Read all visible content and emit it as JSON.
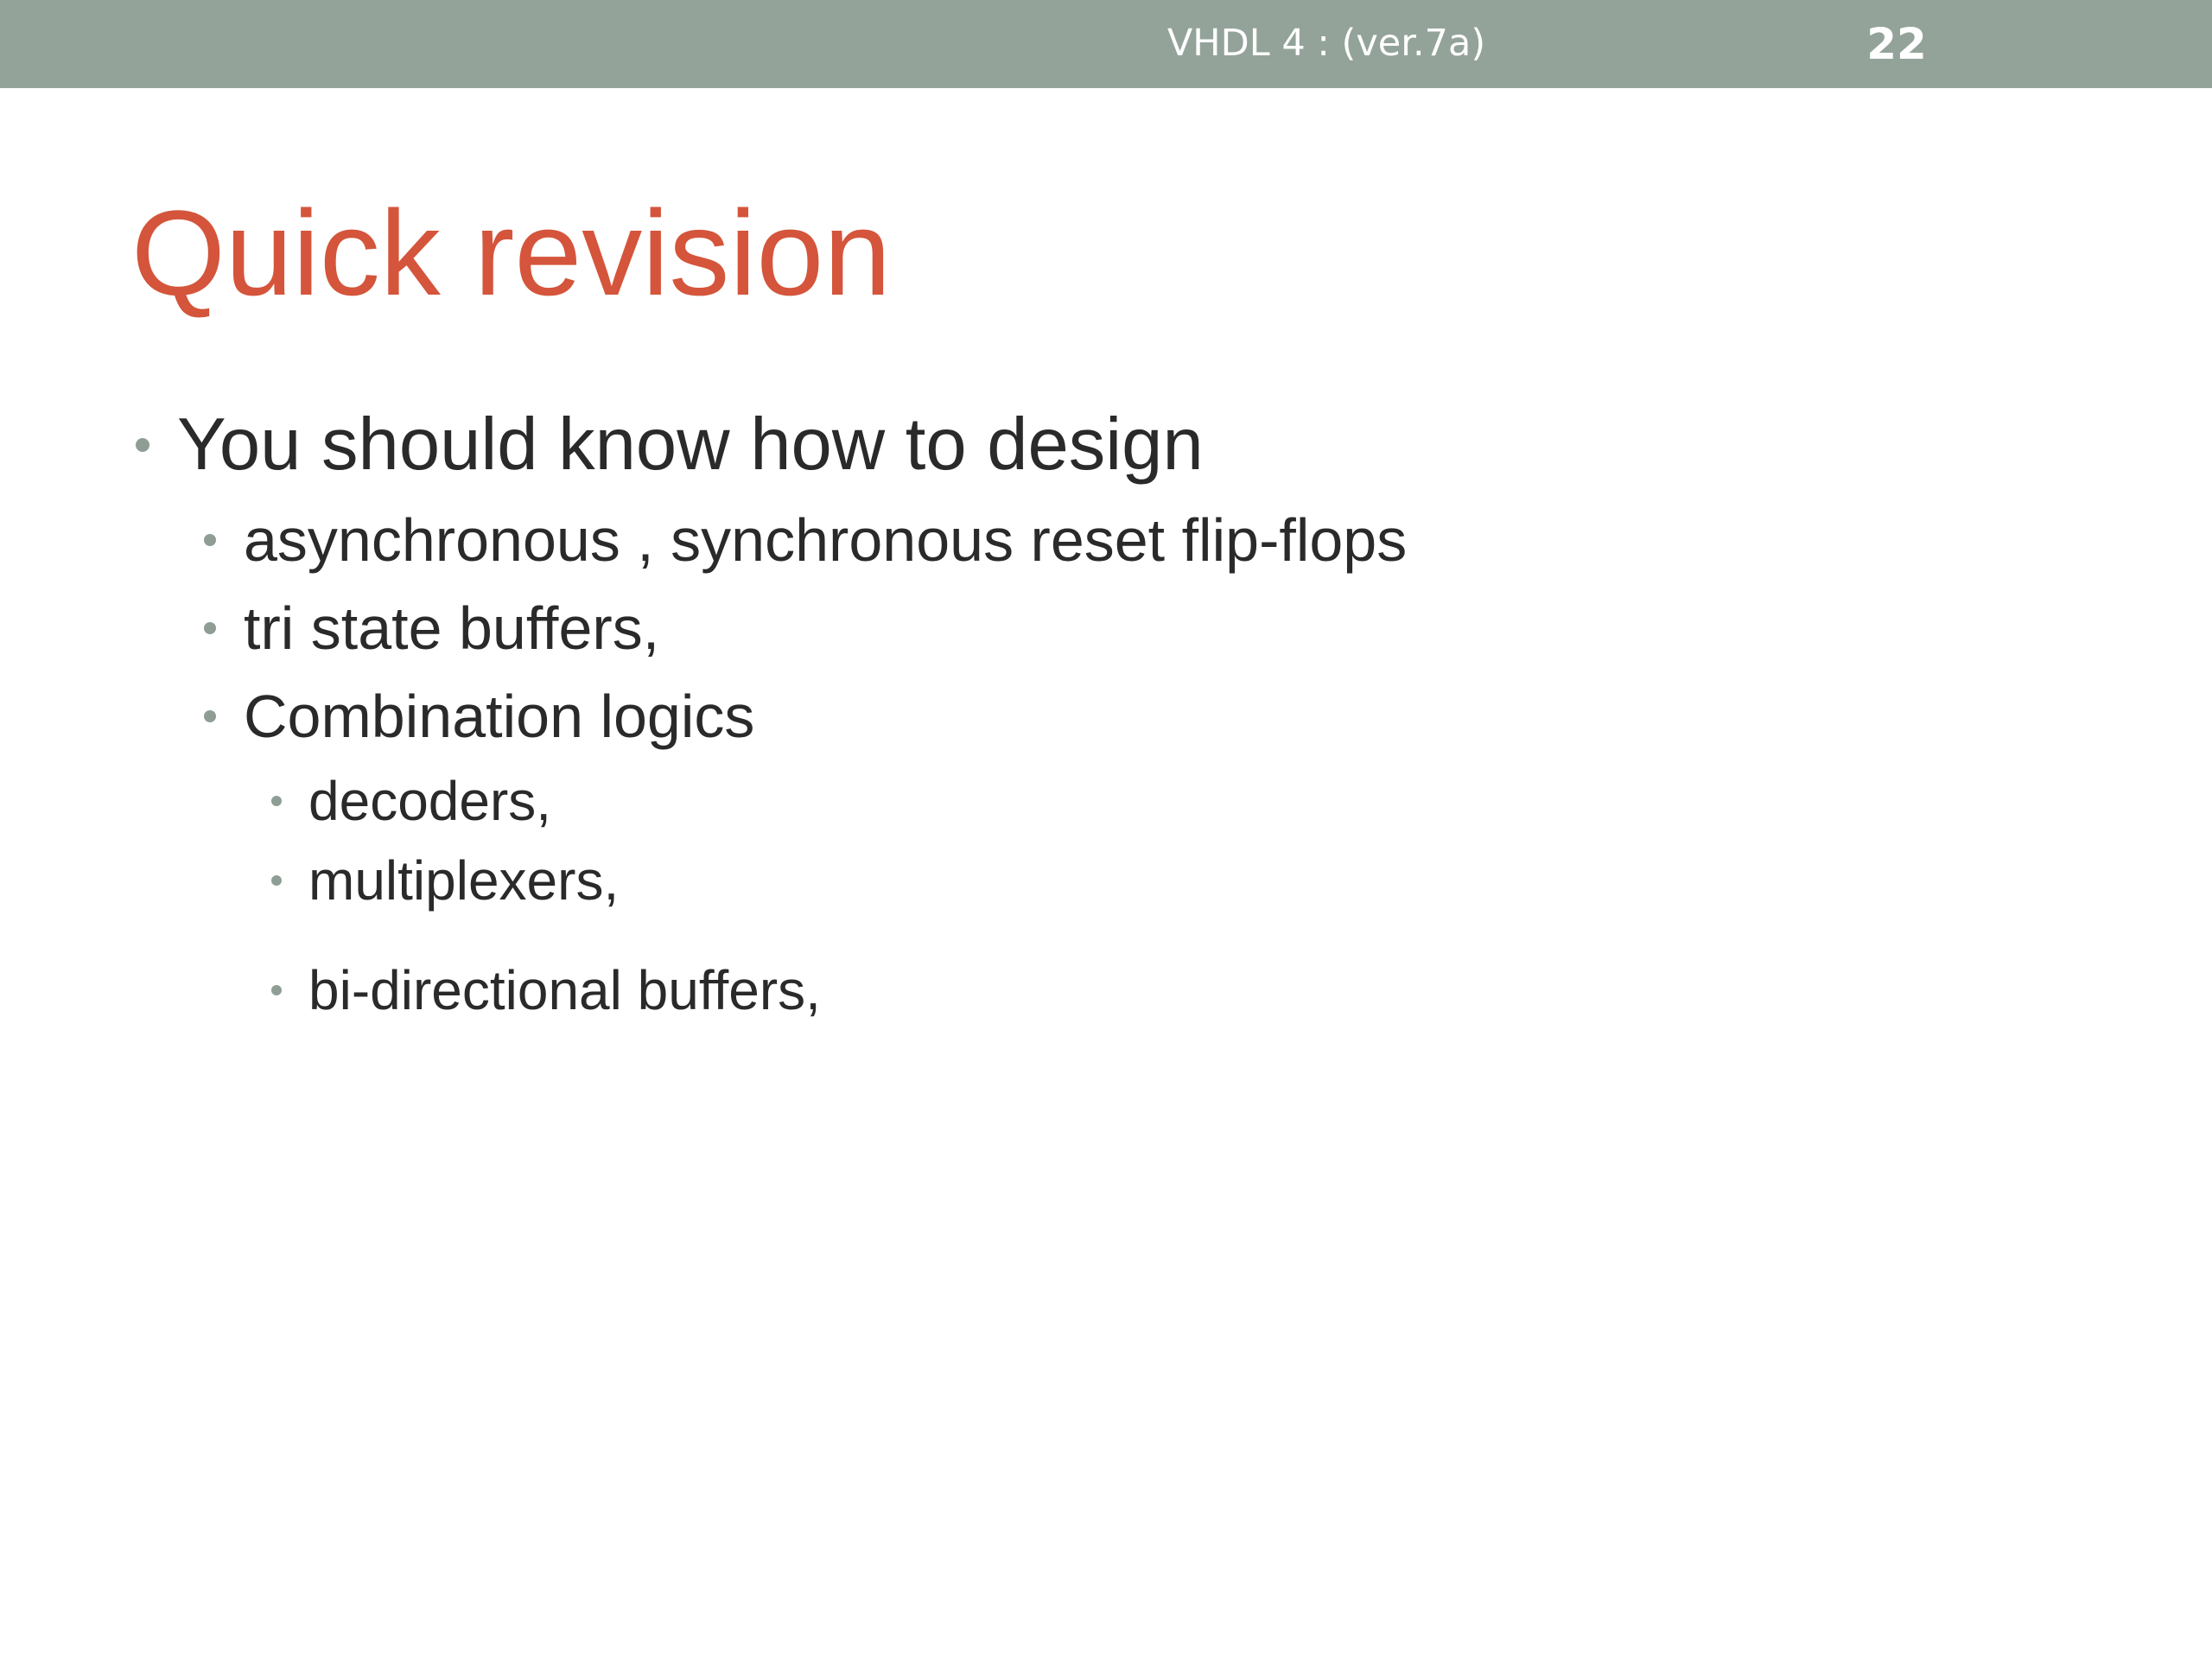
{
  "header": {
    "title": "VHDL 4 : (ver.7a)",
    "slide_number": "22"
  },
  "slide": {
    "title": "Quick revision",
    "bullets": [
      {
        "level": 1,
        "text": "You should know how to design"
      },
      {
        "level": 2,
        "text": "asynchronous , synchronous reset flip-flops"
      },
      {
        "level": 2,
        "text": "tri state buffers,"
      },
      {
        "level": 2,
        "text": "Combination logics"
      },
      {
        "level": 3,
        "text": "decoders,"
      },
      {
        "level": 3,
        "text": "multiplexers,"
      },
      {
        "level": 3,
        "text": "bi-directional buffers,"
      }
    ]
  },
  "colors": {
    "header_bar": "#93a39a",
    "title": "#d4553b",
    "body_text": "#2a2a2a",
    "bullet": "#8e9e95"
  }
}
